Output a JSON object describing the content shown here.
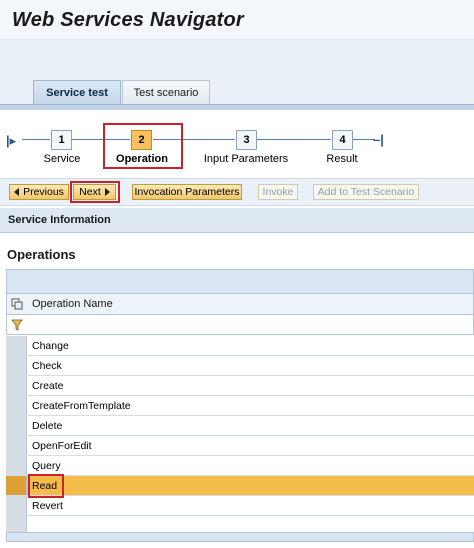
{
  "app": {
    "title": "Web Services Navigator"
  },
  "tabs": [
    {
      "label": "Service test",
      "active": true
    },
    {
      "label": "Test scenario",
      "active": false
    }
  ],
  "roadmap": {
    "steps": [
      {
        "number": "1",
        "label": "Service",
        "active": false
      },
      {
        "number": "2",
        "label": "Operation",
        "active": true
      },
      {
        "number": "3",
        "label": "Input Parameters",
        "active": false
      },
      {
        "number": "4",
        "label": "Result",
        "active": false
      }
    ]
  },
  "toolbar": {
    "previous": "Previous",
    "next": "Next",
    "invocation_parameters": "Invocation Parameters",
    "invoke": "Invoke",
    "add_to_test_scenario": "Add to Test Scenario"
  },
  "section": {
    "title": "Service Information"
  },
  "operations": {
    "title": "Operations",
    "column_header": "Operation Name",
    "rows": [
      {
        "name": "Change",
        "selected": false
      },
      {
        "name": "Check",
        "selected": false
      },
      {
        "name": "Create",
        "selected": false
      },
      {
        "name": "CreateFromTemplate",
        "selected": false
      },
      {
        "name": "Delete",
        "selected": false
      },
      {
        "name": "OpenForEdit",
        "selected": false
      },
      {
        "name": "Query",
        "selected": false
      },
      {
        "name": "Read",
        "selected": true
      },
      {
        "name": "Revert",
        "selected": false
      }
    ]
  },
  "colors": {
    "accent": "#f5bb4b",
    "highlight_border": "#c7232b",
    "header_blue": "#dde7f2"
  },
  "icons": {
    "road_start": "roadmap-start-icon",
    "road_end": "roadmap-end-icon",
    "column_settings": "column-settings-icon",
    "filter": "filter-icon"
  }
}
